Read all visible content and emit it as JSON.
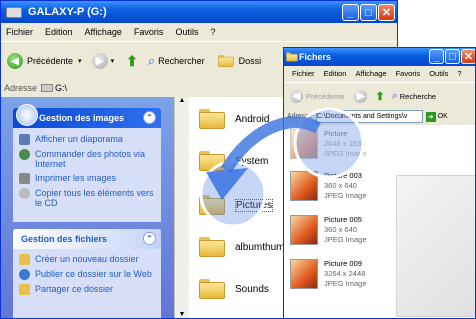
{
  "main_window": {
    "title": "GALAXY-P (G:)",
    "menu": [
      "Fichier",
      "Edition",
      "Affichage",
      "Favoris",
      "Outils",
      "?"
    ],
    "toolbar": {
      "back": "Précédente",
      "search": "Rechercher",
      "folders": "Dossi"
    },
    "address_label": "Adresse",
    "address_value": "G:\\",
    "tasks_images": {
      "title": "Gestion des images",
      "items": [
        "Afficher un diaporama",
        "Commander des photos via Internet",
        "Imprimer les images",
        "Copier tous les éléments vers le CD"
      ]
    },
    "tasks_files": {
      "title": "Gestion des fichiers",
      "items": [
        "Créer un nouveau dossier",
        "Publier ce dossier sur le Web",
        "Partager ce dossier"
      ]
    },
    "folders": [
      "Android",
      "System",
      "Pictures",
      "albumthum",
      "Sounds"
    ]
  },
  "second_window": {
    "title": "Fichers",
    "menu": [
      "Fichier",
      "Edition",
      "Affichage",
      "Favoris",
      "Outils",
      "?"
    ],
    "toolbar": {
      "back": "Précédente",
      "search": "Recherche"
    },
    "address_label": "Adresse",
    "address_value": "C:\\Documents and Settings\\v",
    "go_label": "OK",
    "files": [
      {
        "name": "Picture",
        "dims": "2048 x 1536",
        "type": "JPEG Image"
      },
      {
        "name": "Picture 003",
        "dims": "360 x 640",
        "type": "JPEG Image"
      },
      {
        "name": "Picture 005",
        "dims": "360 x 640",
        "type": "JPEG Image"
      },
      {
        "name": "Picture 009",
        "dims": "3264 x 2448",
        "type": "JPEG Image"
      }
    ]
  }
}
